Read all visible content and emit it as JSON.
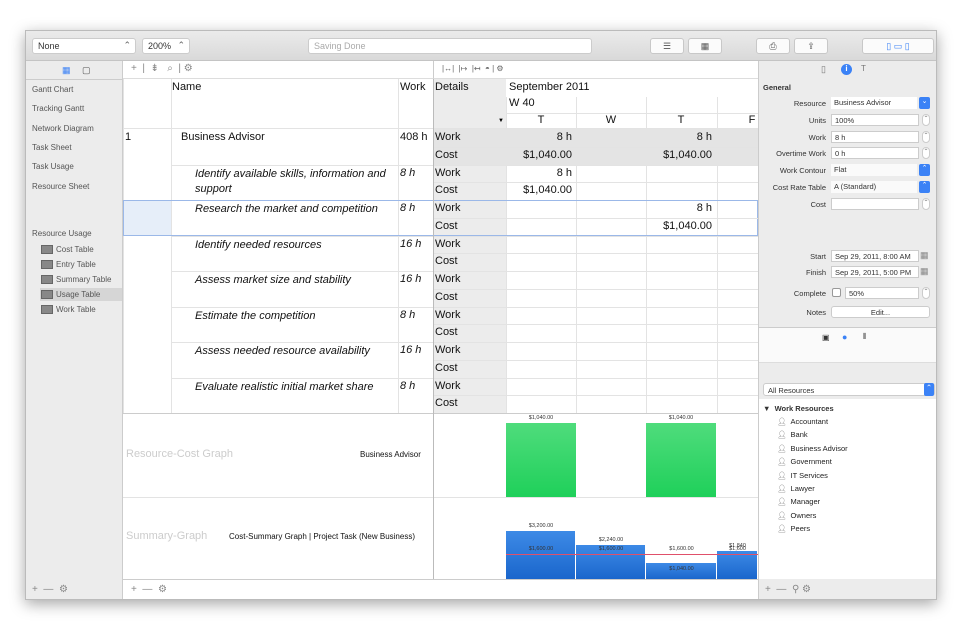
{
  "toolbar": {
    "filter": "None",
    "zoom": "200%",
    "status": "Saving Done"
  },
  "sidebar": {
    "views": [
      "Gantt Chart",
      "Tracking Gantt",
      "Network Diagram",
      "Task Sheet",
      "Task Usage",
      "Resource Sheet",
      "Resource Usage"
    ],
    "tables": [
      "Cost Table",
      "Entry Table",
      "Summary Table",
      "Usage Table",
      "Work Table"
    ],
    "selected_table": "Usage Table"
  },
  "table": {
    "headers": {
      "name": "Name",
      "work": "Work",
      "details": "Details"
    },
    "timescale": {
      "month": "September 2011",
      "week": "W 40",
      "days": [
        "T",
        "W",
        "T",
        "F"
      ]
    },
    "rows": [
      {
        "id": "1",
        "name": "Business Advisor",
        "work": "408 h",
        "summary": true,
        "work_values": [
          "8 h",
          "",
          "8 h",
          ""
        ],
        "cost_values": [
          "$1,040.00",
          "",
          "$1,040.00",
          ""
        ]
      },
      {
        "id": "",
        "name": "Identify available skills, information and support",
        "work": "8 h",
        "work_values": [
          "8 h",
          "",
          "",
          ""
        ],
        "cost_values": [
          "$1,040.00",
          "",
          "",
          ""
        ]
      },
      {
        "id": "",
        "name": "Research the market and competition",
        "work": "8 h",
        "selected": true,
        "work_values": [
          "",
          "",
          "8 h",
          ""
        ],
        "cost_values": [
          "",
          "",
          "$1,040.00",
          ""
        ]
      },
      {
        "id": "",
        "name": "Identify needed resources",
        "work": "16 h",
        "work_values": [
          "",
          "",
          "",
          ""
        ],
        "cost_values": [
          "",
          "",
          "",
          ""
        ]
      },
      {
        "id": "",
        "name": "Assess market size and stability",
        "work": "16 h",
        "work_values": [
          "",
          "",
          "",
          ""
        ],
        "cost_values": [
          "",
          "",
          "",
          ""
        ]
      },
      {
        "id": "",
        "name": "Estimate the competition",
        "work": "8 h",
        "work_values": [
          "",
          "",
          "",
          ""
        ],
        "cost_values": [
          "",
          "",
          "",
          ""
        ]
      },
      {
        "id": "",
        "name": "Assess needed resource availability",
        "work": "16 h",
        "work_values": [
          "",
          "",
          "",
          ""
        ],
        "cost_values": [
          "",
          "",
          "",
          ""
        ]
      },
      {
        "id": "",
        "name": "Evaluate realistic initial market share",
        "work": "8 h",
        "work_values": [
          "",
          "",
          "",
          ""
        ],
        "cost_values": [
          "",
          "",
          "",
          ""
        ]
      }
    ],
    "detail_labels": {
      "work": "Work",
      "cost": "Cost"
    }
  },
  "graphs": {
    "resource_cost": {
      "label": "Resource-Cost Graph",
      "resource": "Business Advisor",
      "bars": [
        {
          "day": 0,
          "value": 1040,
          "label": "$1,040.00"
        },
        {
          "day": 2,
          "value": 1040,
          "label": "$1,040.00"
        }
      ]
    },
    "summary": {
      "label": "Summary-Graph",
      "title": "Cost-Summary Graph | Project Task (New Business)",
      "bars": [
        {
          "value": 3200,
          "label": "$3,200.00",
          "line": "$1,600.00"
        },
        {
          "value": 2240,
          "label": "$2,240.00",
          "line": "$1,600.00"
        },
        {
          "value": 1040,
          "label": "$1,040.00",
          "line": "$1,600.00"
        },
        {
          "value": 1840,
          "label": "$1,840",
          "line": "$1,600"
        }
      ]
    }
  },
  "inspector": {
    "section": "General",
    "fields": [
      {
        "label": "Resource",
        "value": "Business Advisor",
        "type": "popup"
      },
      {
        "label": "Units",
        "value": "100%",
        "type": "stepper"
      },
      {
        "label": "Work",
        "value": "8 h",
        "type": "stepper"
      },
      {
        "label": "Overtime Work",
        "value": "0 h",
        "type": "stepper"
      },
      {
        "label": "Work Contour",
        "value": "Flat",
        "type": "select"
      },
      {
        "label": "Cost Rate Table",
        "value": "A (Standard)",
        "type": "select"
      },
      {
        "label": "Cost",
        "value": "",
        "type": "stepper"
      }
    ],
    "start_label": "Start",
    "start": "Sep 29, 2011, 8:00 AM",
    "finish_label": "Finish",
    "finish": "Sep 29, 2011, 5:00 PM",
    "complete_label": "Complete",
    "complete": "50%",
    "notes_label": "Notes",
    "notes_button": "Edit...",
    "resource_filter": "All Resources",
    "group": "Work Resources",
    "resources": [
      "Accountant",
      "Bank",
      "Business Advisor",
      "Government",
      "IT Services",
      "Lawyer",
      "Manager",
      "Owners",
      "Peers"
    ]
  },
  "colors": {
    "accent": "#3b82f6",
    "green": "#1fd05a",
    "blue": "#2a78d8"
  }
}
